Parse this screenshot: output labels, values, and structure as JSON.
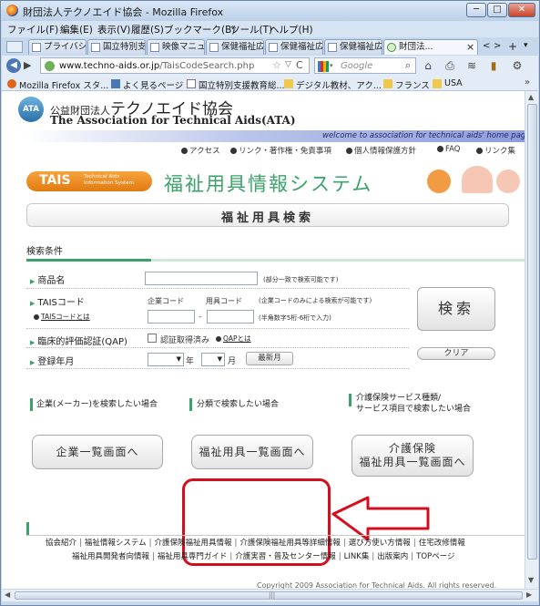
{
  "window": {
    "title": "財団法人テクノエイド協会 - Mozilla Firefox",
    "buttons": {
      "minimize": "─",
      "maximize": "□",
      "close": "✕"
    }
  },
  "menu": [
    "ファイル(F)",
    "編集(E)",
    "表示(V)",
    "履歴(S)",
    "ブックマーク(B)",
    "ツール(T)",
    "ヘルプ(H)"
  ],
  "tabs": [
    {
      "label": "プライバシ..."
    },
    {
      "label": "国立特別支..."
    },
    {
      "label": "映像マニュ..."
    },
    {
      "label": "保健福祉広..."
    },
    {
      "label": "保健福祉広..."
    },
    {
      "label": "保健福祉広..."
    },
    {
      "label": "財団法..."
    }
  ],
  "tab_controls": {
    "close": "×",
    "scroll_left": "<",
    "scroll_right": ">",
    "new": "+",
    "list": "▾"
  },
  "nav": {
    "back": "◀",
    "forward": "▶",
    "url_domain": "www.techno-aids.or.jp",
    "url_path": "/TaisCodeSearch.php",
    "star": "☆",
    "dropdown": "▽",
    "reload": "C",
    "search_placeholder": "Google",
    "search_icon": "⌕",
    "home": "⌂",
    "print": "⎙",
    "feed": "≋",
    "bookmark_icon": "▮",
    "addon": "⚙"
  },
  "bookmarks": [
    {
      "label": "Mozilla Firefox スタ..."
    },
    {
      "label": "よく見るページ"
    },
    {
      "label": "国立特別支援教育総..."
    },
    {
      "label": "デジタル教材、アク..."
    },
    {
      "label": "フランス"
    },
    {
      "label": "USA"
    }
  ],
  "bookmarks_more": "»",
  "site": {
    "logo_text": "ATA",
    "org_prefix": "公益財団法人",
    "org_name": "テクノエイド協会",
    "org_en": "The Association for Technical Aids(ATA)",
    "welcome": "welcome to association for technical aids' home page",
    "top_links": [
      "アクセス",
      "リンク・著作権・免責事項",
      "個人情報保護方針",
      "FAQ",
      "リンク集"
    ],
    "tais_badge": "TAIS",
    "tais_badge_sub": "Technical Aids Information System",
    "system_title": "福祉用具情報システム",
    "search_heading": "福祉用具検索"
  },
  "search": {
    "conditions_label": "検索条件",
    "rows": [
      {
        "label": "商品名",
        "hint": "(部分一致で検索可能です)"
      },
      {
        "label": "TAISコード",
        "link": "TAISコードとは",
        "company_code_label": "企業コード",
        "product_code_label": "用具コード",
        "hint": "(企業コードのみによる検索が可能です)",
        "hint2": "(半角数字5桁-6桁で入力)",
        "dash": "-"
      },
      {
        "label": "臨床的評価認証(QAP)",
        "checkbox_label": "認証取得済み",
        "link": "QAPとは"
      },
      {
        "label": "登録年月",
        "year_suffix": "年",
        "month_suffix": "月",
        "latest_button": "最新月"
      }
    ],
    "select_arrow": "▼",
    "search_button": "検索",
    "clear_button": "クリア"
  },
  "columns": [
    {
      "heading": "企業(メーカー)を検索したい場合",
      "button": "企業一覧画面へ"
    },
    {
      "heading": "分類で検索したい場合",
      "button": "福祉用具一覧画面へ"
    },
    {
      "heading_line1": "介護保険サービス種類/",
      "heading_line2": "サービス項目で検索したい場合",
      "button_line1": "介護保険",
      "button_line2": "福祉用具一覧画面へ"
    }
  ],
  "footer": {
    "line1": [
      "協会紹介",
      "福祉情報システム",
      "介護保険福祉用具情報",
      "介護保険福祉用具等詳細情報",
      "選び方使い方情報",
      "住宅改修情報"
    ],
    "line2": [
      "福祉用具開発者向情報",
      "福祉用具専門ガイド",
      "介護実習・普及センター情報",
      "LINK集",
      "出版案内",
      "TOPページ"
    ],
    "separator": "|",
    "copyright": "Copyright 2009 Association for Technical Aids. All rights reserved."
  },
  "colors": {
    "accent_green": "#3aa36a",
    "tais_orange": "#f08a24",
    "highlight_red": "#d40f1d"
  }
}
